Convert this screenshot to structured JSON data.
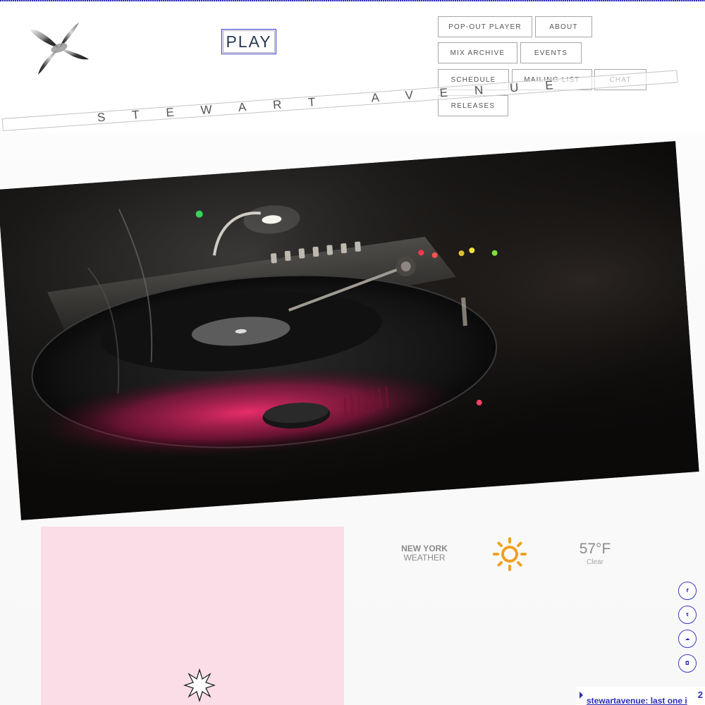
{
  "header": {
    "logo_icon": "four-point-chrome-star-logo",
    "play_label": "PLAY",
    "nav": [
      {
        "label": "POP-OUT PLAYER"
      },
      {
        "label": "ABOUT"
      },
      {
        "label": "MIX ARCHIVE"
      },
      {
        "label": "EVENTS"
      },
      {
        "label": "SCHEDULE"
      },
      {
        "label": "MAILING LIST"
      },
      {
        "label": "CHAT"
      },
      {
        "label": "RELEASES"
      }
    ]
  },
  "banner": {
    "text": "STEWART AVENUE"
  },
  "hero": {
    "icon": "turntable-photo"
  },
  "weather": {
    "city": "NEW YORK",
    "label": "WEATHER",
    "icon": "sun-icon",
    "temperature": "57°F",
    "condition": "Clear"
  },
  "panel": {
    "color": "#fadde6",
    "icon": "star-outline-icon"
  },
  "social": [
    {
      "icon": "facebook-icon",
      "glyph": "f"
    },
    {
      "icon": "twitter-icon",
      "glyph": "t"
    },
    {
      "icon": "soundcloud-icon",
      "glyph": "☁"
    },
    {
      "icon": "instagram-icon",
      "glyph": "◘"
    }
  ],
  "ticker": {
    "text": "stewartavenue: last one i",
    "count": "2"
  },
  "colors": {
    "accent": "#2d2db8",
    "sun": "#f0a020"
  }
}
